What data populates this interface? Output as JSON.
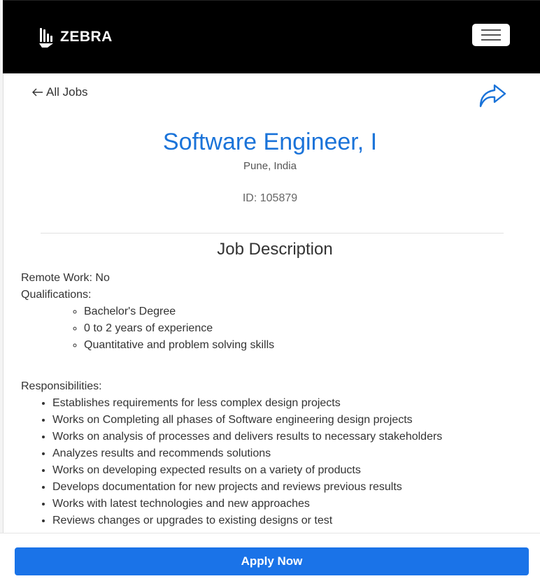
{
  "header": {
    "logo_text": "ZEBRA",
    "logo_icon": "zebra-stripes-icon",
    "menu_icon": "hamburger-menu-icon"
  },
  "nav": {
    "back_label": "All Jobs",
    "back_icon": "arrow-left-icon",
    "share_icon": "share-arrow-icon"
  },
  "job": {
    "title": "Software Engineer, I",
    "location": "Pune, India",
    "id_label": "ID: 105879"
  },
  "description": {
    "section_title": "Job Description",
    "remote_work": "Remote Work: No",
    "qualifications_label": "Qualifications:",
    "qualifications": [
      "Bachelor's Degree",
      "0 to 2 years of experience",
      "Quantitative and problem solving skills"
    ],
    "responsibilities_label": "Responsibilities:",
    "responsibilities": [
      "Establishes requirements for less complex design projects",
      "Works on Completing all phases of Software engineering design projects",
      "Works on analysis of processes and delivers results to necessary stakeholders",
      "Analyzes results and recommends solutions",
      "Works on developing expected results on a variety of products",
      "Develops documentation for new projects and reviews previous results",
      "Works with latest technologies and new approaches",
      "Reviews changes or upgrades to existing designs or test"
    ]
  },
  "apply": {
    "button_label": "Apply Now"
  },
  "colors": {
    "accent": "#1a73e8",
    "header_bg": "#000000",
    "title_color": "#1a73d9"
  }
}
